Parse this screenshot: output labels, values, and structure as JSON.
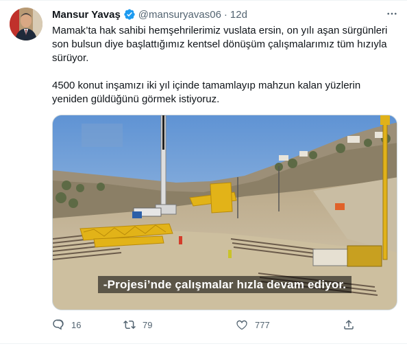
{
  "tweet": {
    "author_name": "Mansur Yavaş",
    "handle": "@mansuryavas06",
    "separator": "·",
    "time": "12d",
    "paragraphs": [
      "Mamak’ta hak sahibi hemşehrilerimiz vuslata ersin, on yılı aşan sürgünleri son bulsun diye başlattığımız kentsel dönüşüm çalışmalarımız tüm hızıyla sürüyor.",
      "4500 konut inşamızı iki yıl içinde tamamlayıp mahzun kalan yüzlerin yeniden güldüğünü görmek istiyoruz."
    ],
    "video_caption": "-Projesi’nde çalışmalar hızla devam ediyor.",
    "metrics": {
      "replies": "16",
      "retweets": "79",
      "likes": "777"
    }
  },
  "icons": {
    "verified": "verified-badge-icon",
    "more": "more-options-icon",
    "reply": "reply-icon",
    "retweet": "retweet-icon",
    "like": "heart-icon",
    "share": "share-icon"
  },
  "colors": {
    "verified": "#1d9bf0",
    "text_secondary": "#536471",
    "text_primary": "#0f1419",
    "border": "#cfd9de"
  }
}
